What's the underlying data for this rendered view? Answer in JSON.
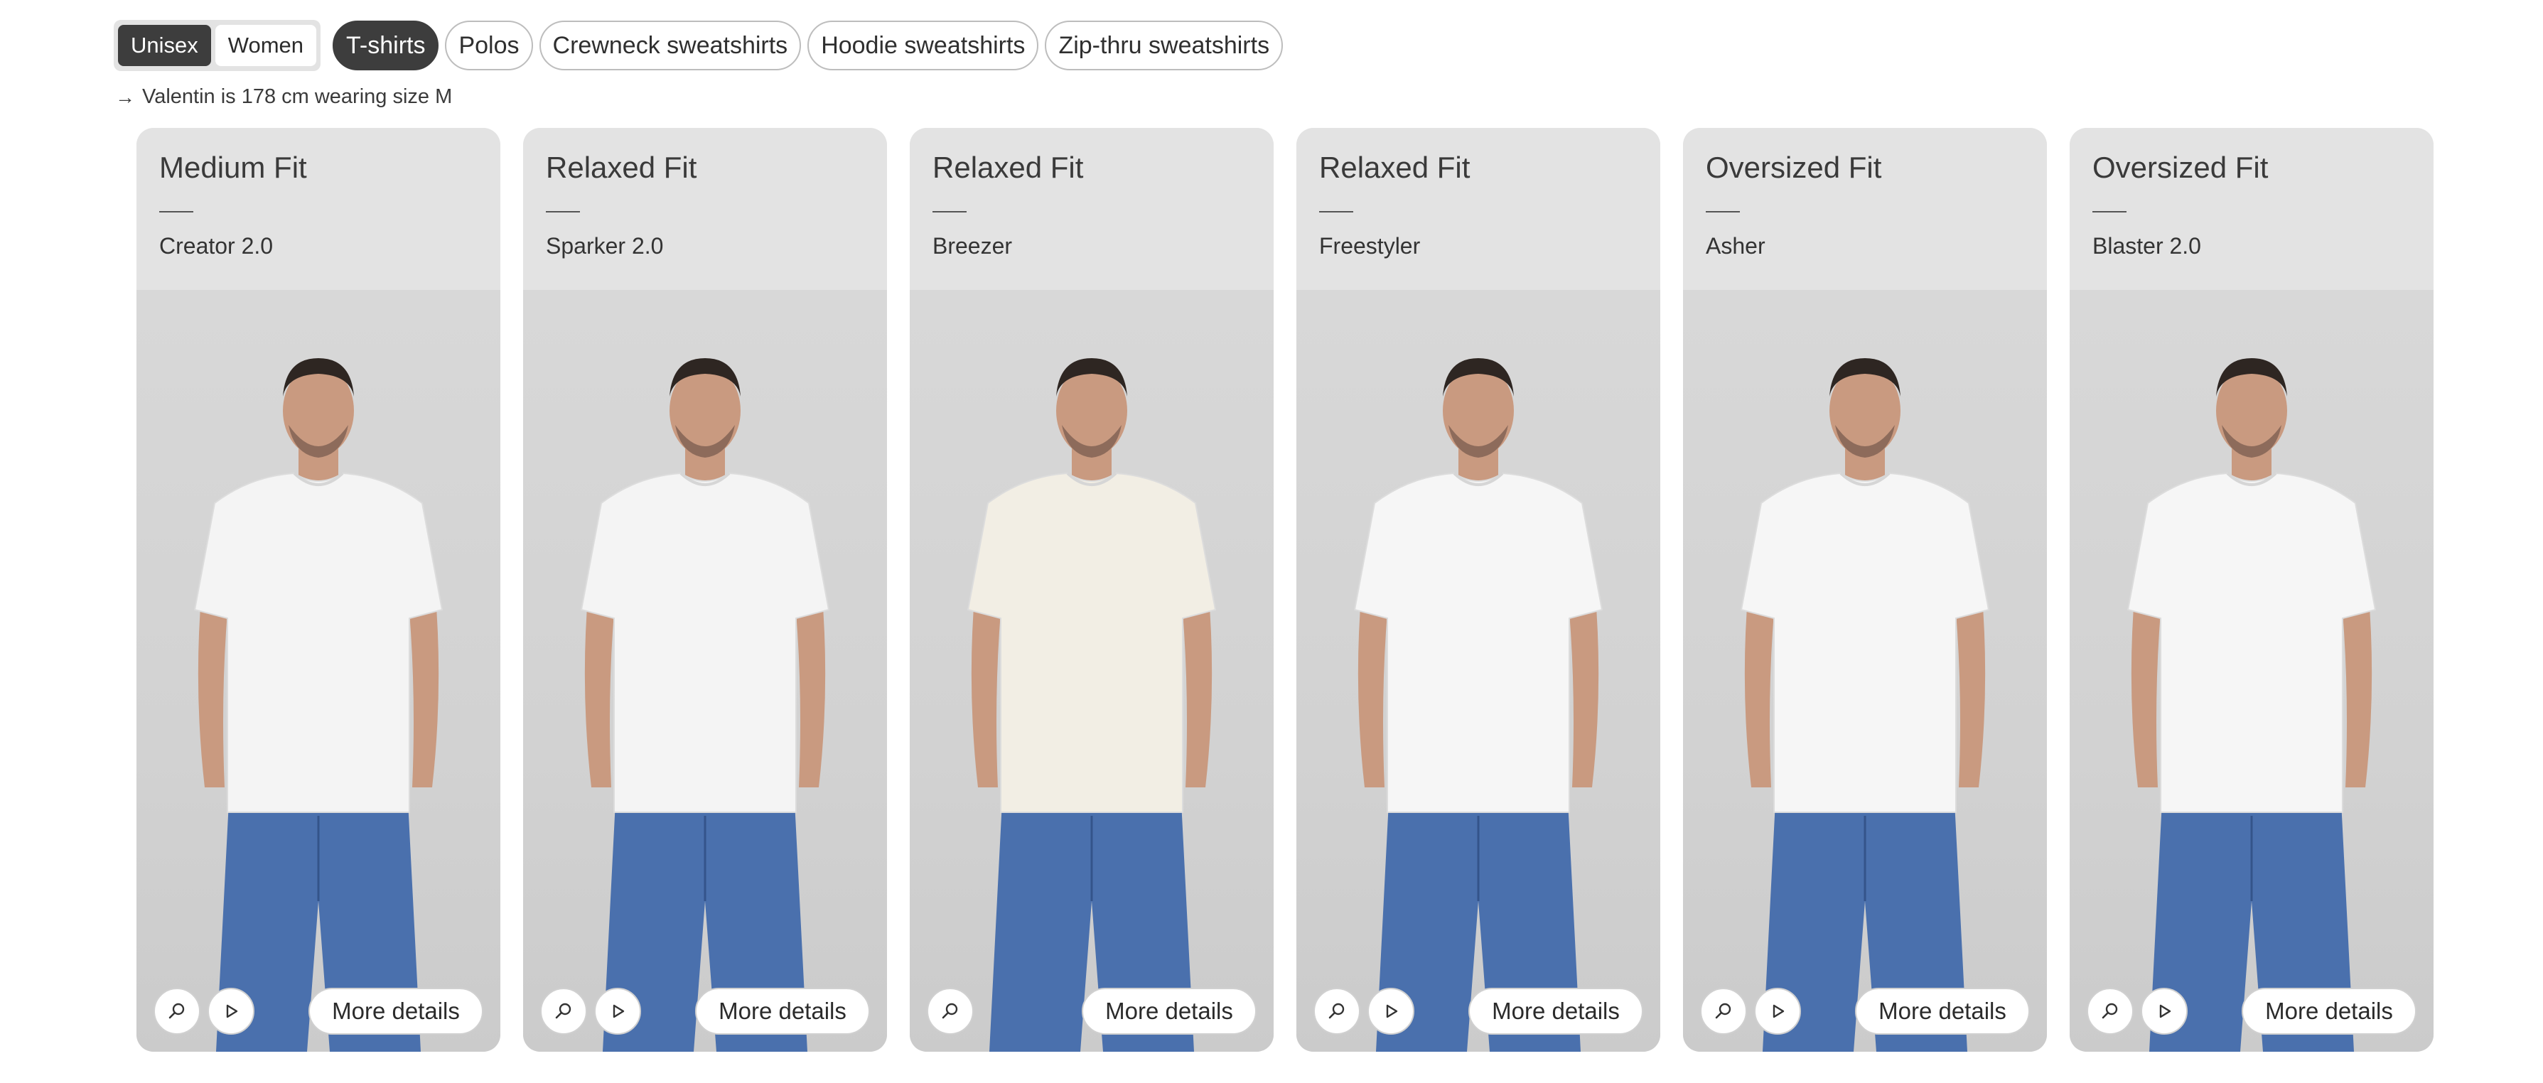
{
  "filters": {
    "gender": [
      {
        "label": "Unisex",
        "active": true
      },
      {
        "label": "Women",
        "active": false
      }
    ],
    "categories": [
      {
        "label": "T-shirts",
        "active": true
      },
      {
        "label": "Polos",
        "active": false
      },
      {
        "label": "Crewneck sweatshirts",
        "active": false
      },
      {
        "label": "Hoodie sweatshirts",
        "active": false
      },
      {
        "label": "Zip-thru sweatshirts",
        "active": false
      }
    ]
  },
  "model_note": {
    "arrow": "→",
    "text": "Valentin is 178 cm wearing size M"
  },
  "cards": [
    {
      "fit": "Medium Fit",
      "style": "Creator 2.0",
      "details_label": "More details",
      "has_video": true,
      "shirt_color": "#f4f4f4"
    },
    {
      "fit": "Relaxed Fit",
      "style": "Sparker 2.0",
      "details_label": "More details",
      "has_video": true,
      "shirt_color": "#f4f4f4"
    },
    {
      "fit": "Relaxed Fit",
      "style": "Breezer",
      "details_label": "More details",
      "has_video": false,
      "shirt_color": "#f2eee4"
    },
    {
      "fit": "Relaxed Fit",
      "style": "Freestyler",
      "details_label": "More details",
      "has_video": true,
      "shirt_color": "#f6f6f6"
    },
    {
      "fit": "Oversized Fit",
      "style": "Asher",
      "details_label": "More details",
      "has_video": true,
      "shirt_color": "#f6f6f6"
    },
    {
      "fit": "Oversized Fit",
      "style": "Blaster 2.0",
      "details_label": "More details",
      "has_video": true,
      "shirt_color": "#f6f6f6"
    }
  ],
  "colors": {
    "active_pill": "#3d3d3d",
    "card_bg": "#e3e3e3",
    "jeans": "#4a70ad",
    "skin": "#c99a80"
  }
}
